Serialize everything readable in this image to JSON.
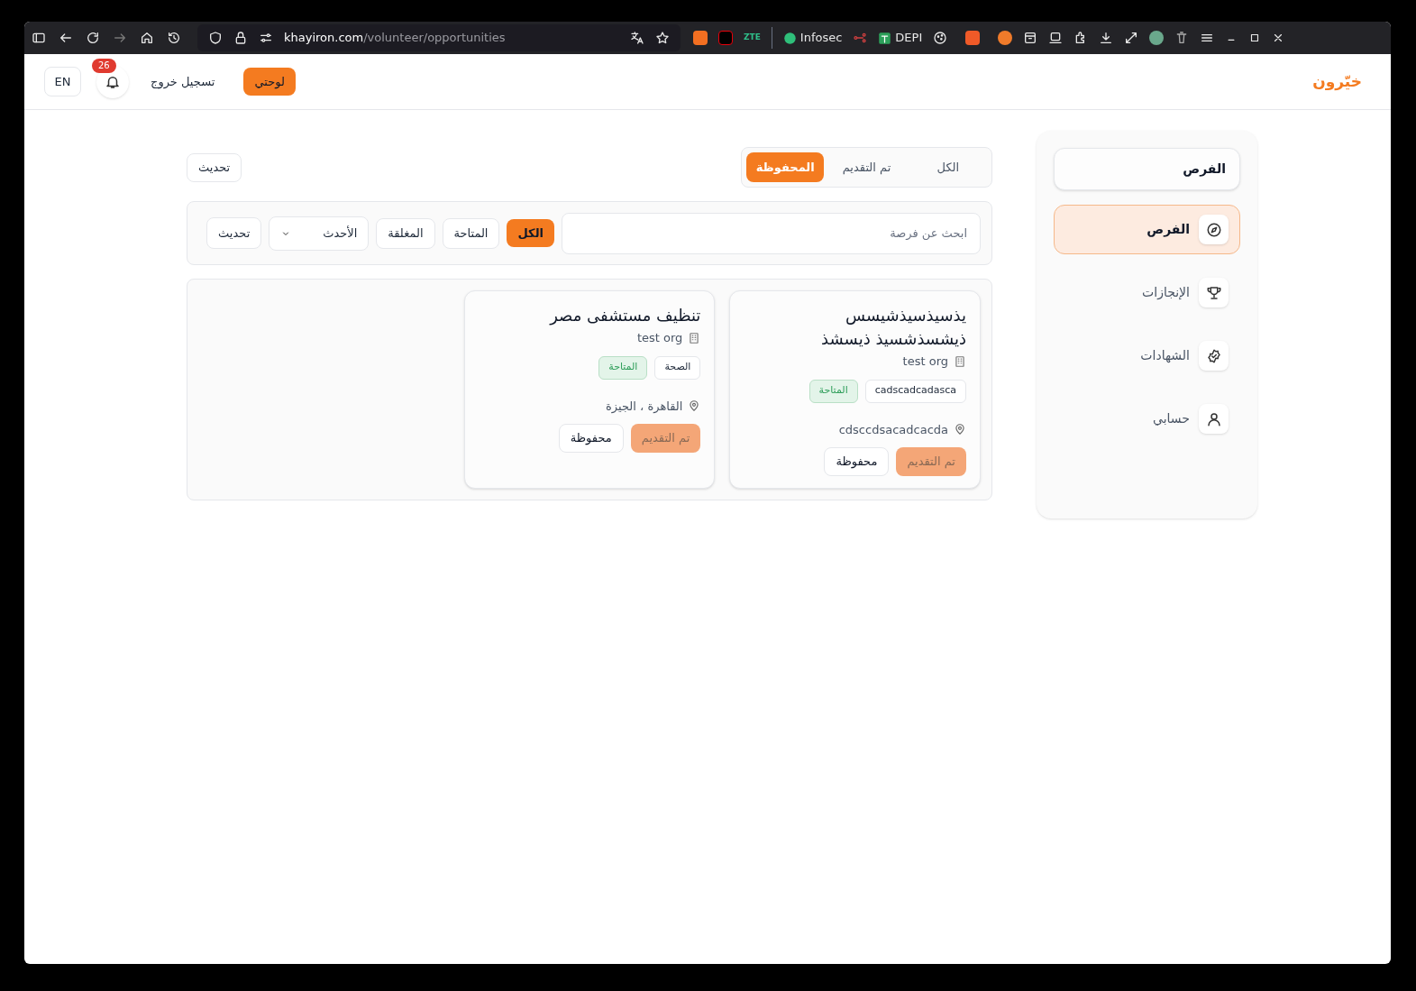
{
  "browser": {
    "url_host": "khayiron.com",
    "url_path": "/volunteer/opportunities",
    "extension_label": "ZTE",
    "bookmark": "Infosec",
    "pinned_bookmark": "DEPI"
  },
  "header": {
    "brand": "خيّرون",
    "dashboard_button": "لوحتي",
    "logout": "تسجيل خروج",
    "notification_count": "26",
    "language_button": "EN"
  },
  "sidebar": {
    "heading": "الفرص",
    "items": [
      {
        "label": "الفرص",
        "selected": true
      },
      {
        "label": "الإنجازات",
        "selected": false
      },
      {
        "label": "الشهادات",
        "selected": false
      },
      {
        "label": "حسابي",
        "selected": false
      }
    ]
  },
  "tabs": [
    {
      "label": "الكل",
      "selected": false
    },
    {
      "label": "تم التقديم",
      "selected": false
    },
    {
      "label": "المحفوظة",
      "selected": true
    }
  ],
  "refresh_button": "تحديث",
  "filters": {
    "search": {
      "placeholder": "ابحث عن فرصة"
    },
    "status": [
      {
        "label": "الكل",
        "selected": true
      },
      {
        "label": "المتاحة",
        "selected": false
      },
      {
        "label": "المغلقة",
        "selected": false
      }
    ],
    "sort": "الأحدث",
    "refresh_button": "تحديث"
  },
  "cards": [
    {
      "title": "يذسيذسيذشيسس ذيشسذشسيذ ذيسشذ",
      "org": "test org",
      "tags": [
        {
          "kind": "category",
          "label": "cadscadcadasca"
        },
        {
          "kind": "status",
          "label": "المتاحة"
        }
      ],
      "location": "cdsccdsacadcacda",
      "apply_button": {
        "label": "تم التقديم",
        "disabled": true
      },
      "save_button": "محفوظة"
    },
    {
      "title": "تنظيف مستشفى مصر",
      "org": "test org",
      "tags": [
        {
          "kind": "category",
          "label": "الصحة"
        },
        {
          "kind": "status",
          "label": "المتاحة"
        }
      ],
      "location": "القاهرة ، الجيزة",
      "apply_button": {
        "label": "تم التقديم",
        "disabled": true
      },
      "save_button": "محفوظة"
    }
  ]
}
